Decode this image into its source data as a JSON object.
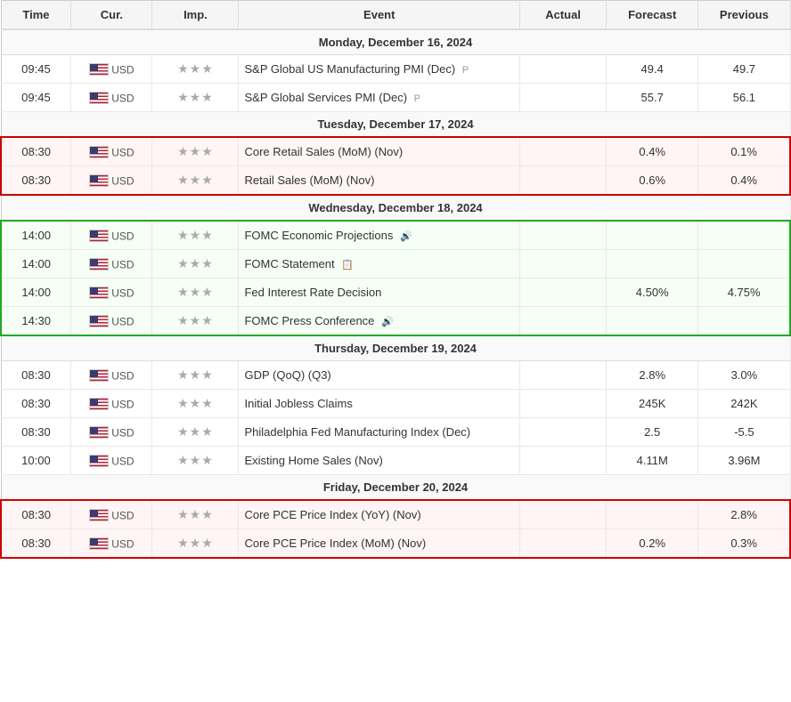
{
  "header": {
    "columns": [
      "Time",
      "Cur.",
      "Imp.",
      "Event",
      "Actual",
      "Forecast",
      "Previous"
    ]
  },
  "sections": [
    {
      "day_label": "Monday, December 16, 2024",
      "rows": [
        {
          "time": "09:45",
          "cur": "USD",
          "imp": "★★★",
          "event": "S&P Global US Manufacturing PMI (Dec)",
          "note": "P",
          "actual": "",
          "forecast": "49.4",
          "previous": "49.7",
          "style": "normal"
        },
        {
          "time": "09:45",
          "cur": "USD",
          "imp": "★★★",
          "event": "S&P Global Services PMI (Dec)",
          "note": "P",
          "actual": "",
          "forecast": "55.7",
          "previous": "56.1",
          "style": "normal"
        }
      ]
    },
    {
      "day_label": "Tuesday, December 17, 2024",
      "rows": [
        {
          "time": "08:30",
          "cur": "USD",
          "imp": "★★★",
          "event": "Core Retail Sales (MoM) (Nov)",
          "note": "",
          "actual": "",
          "forecast": "0.4%",
          "previous": "0.1%",
          "style": "red-top"
        },
        {
          "time": "08:30",
          "cur": "USD",
          "imp": "★★★",
          "event": "Retail Sales (MoM) (Nov)",
          "note": "",
          "actual": "",
          "forecast": "0.6%",
          "previous": "0.4%",
          "style": "red-bottom"
        }
      ]
    },
    {
      "day_label": "Wednesday, December 18, 2024",
      "rows": [
        {
          "time": "14:00",
          "cur": "USD",
          "imp": "★★★",
          "event": "FOMC Economic Projections",
          "note": "speaker",
          "actual": "",
          "forecast": "",
          "previous": "",
          "style": "green-top"
        },
        {
          "time": "14:00",
          "cur": "USD",
          "imp": "★★★",
          "event": "FOMC Statement",
          "note": "doc",
          "actual": "",
          "forecast": "",
          "previous": "",
          "style": "green-mid"
        },
        {
          "time": "14:00",
          "cur": "USD",
          "imp": "★★★",
          "event": "Fed Interest Rate Decision",
          "note": "",
          "actual": "",
          "forecast": "4.50%",
          "previous": "4.75%",
          "style": "green-mid"
        },
        {
          "time": "14:30",
          "cur": "USD",
          "imp": "★★★",
          "event": "FOMC Press Conference",
          "note": "speaker",
          "actual": "",
          "forecast": "",
          "previous": "",
          "style": "green-bottom"
        }
      ]
    },
    {
      "day_label": "Thursday, December 19, 2024",
      "rows": [
        {
          "time": "08:30",
          "cur": "USD",
          "imp": "★★★",
          "event": "GDP (QoQ) (Q3)",
          "note": "",
          "actual": "",
          "forecast": "2.8%",
          "previous": "3.0%",
          "style": "normal"
        },
        {
          "time": "08:30",
          "cur": "USD",
          "imp": "★★★",
          "event": "Initial Jobless Claims",
          "note": "",
          "actual": "",
          "forecast": "245K",
          "previous": "242K",
          "style": "normal"
        },
        {
          "time": "08:30",
          "cur": "USD",
          "imp": "★★★",
          "event": "Philadelphia Fed Manufacturing Index (Dec)",
          "note": "",
          "actual": "",
          "forecast": "2.5",
          "previous": "-5.5",
          "style": "normal"
        },
        {
          "time": "10:00",
          "cur": "USD",
          "imp": "★★★",
          "event": "Existing Home Sales (Nov)",
          "note": "",
          "actual": "",
          "forecast": "4.11M",
          "previous": "3.96M",
          "style": "normal"
        }
      ]
    },
    {
      "day_label": "Friday, December 20, 2024",
      "rows": [
        {
          "time": "08:30",
          "cur": "USD",
          "imp": "★★★",
          "event": "Core PCE Price Index (YoY) (Nov)",
          "note": "",
          "actual": "",
          "forecast": "",
          "previous": "2.8%",
          "style": "red-top"
        },
        {
          "time": "08:30",
          "cur": "USD",
          "imp": "★★★",
          "event": "Core PCE Price Index (MoM) (Nov)",
          "note": "",
          "actual": "",
          "forecast": "0.2%",
          "previous": "0.3%",
          "style": "red-bottom"
        }
      ]
    }
  ],
  "icons": {
    "speaker": "🔊",
    "doc": "📋",
    "star_filled": "★",
    "star_empty": "☆",
    "flag": "🇺🇸"
  }
}
